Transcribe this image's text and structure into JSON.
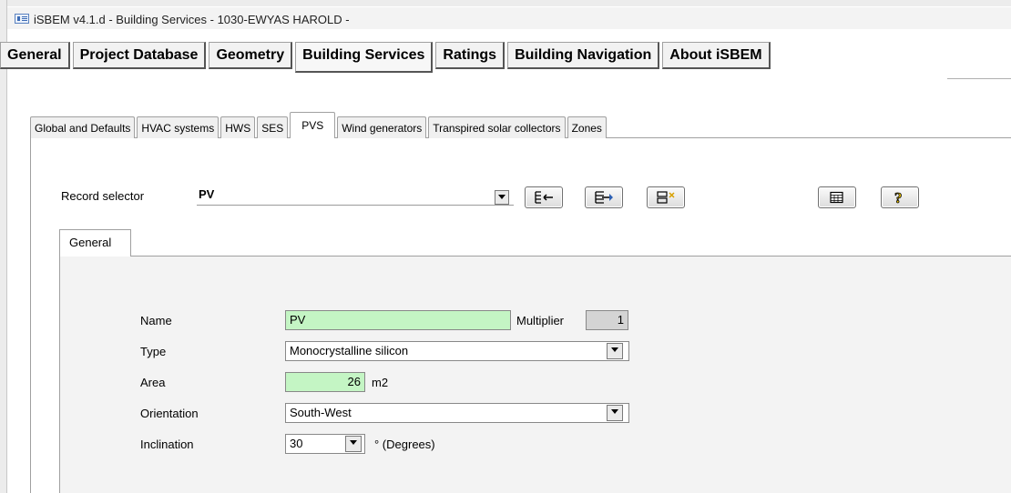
{
  "window": {
    "title": "iSBEM v4.1.d - Building Services - 1030-EWYAS HAROLD -",
    "app_icon": "form-icon"
  },
  "main_tabs": [
    {
      "label": "General"
    },
    {
      "label": "Project Database"
    },
    {
      "label": "Geometry"
    },
    {
      "label": "Building Services",
      "active": true
    },
    {
      "label": "Ratings"
    },
    {
      "label": "Building Navigation"
    },
    {
      "label": "About iSBEM"
    }
  ],
  "sub_tabs": [
    {
      "label": "Global and Defaults"
    },
    {
      "label": "HVAC systems"
    },
    {
      "label": "HWS"
    },
    {
      "label": "SES"
    },
    {
      "label": "PVS",
      "active": true
    },
    {
      "label": "Wind generators"
    },
    {
      "label": "Transpired solar collectors"
    },
    {
      "label": "Zones"
    }
  ],
  "record_selector": {
    "label": "Record selector",
    "value": "PV",
    "buttons": [
      {
        "name": "add-record-button",
        "icon": "add-record-icon"
      },
      {
        "name": "copy-record-button",
        "icon": "copy-record-icon"
      },
      {
        "name": "delete-record-button",
        "icon": "delete-record-icon"
      },
      {
        "name": "table-view-button",
        "icon": "table-icon"
      },
      {
        "name": "help-button",
        "icon": "question-mark-icon"
      }
    ]
  },
  "inner_tab": {
    "label": "General"
  },
  "form": {
    "name": {
      "label": "Name",
      "value": "PV"
    },
    "multiplier": {
      "label": "Multiplier",
      "value": "1"
    },
    "type": {
      "label": "Type",
      "value": "Monocrystalline silicon"
    },
    "area": {
      "label": "Area",
      "value": "26",
      "unit": "m2"
    },
    "orientation": {
      "label": "Orientation",
      "value": "South-West"
    },
    "inclination": {
      "label": "Inclination",
      "value": "30",
      "unit": "° (Degrees)"
    }
  },
  "colors": {
    "required_field": "#c4f5c4",
    "readonly_field": "#d4d4d4"
  }
}
